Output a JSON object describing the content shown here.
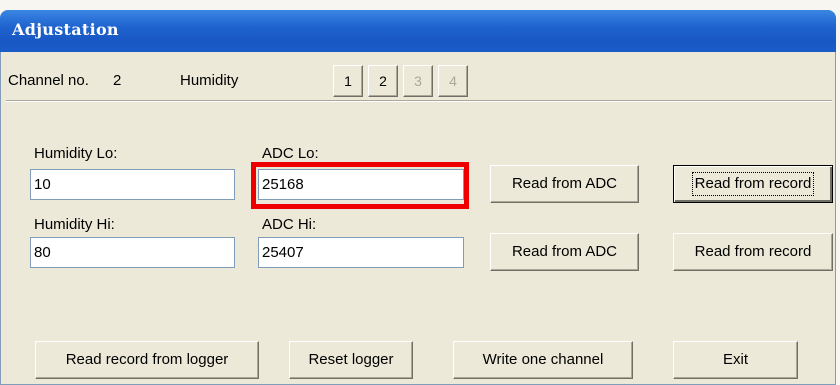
{
  "window": {
    "title": "Adjustation"
  },
  "header": {
    "channel_label": "Channel no.",
    "channel_number": "2",
    "channel_type": "Humidity",
    "channel_buttons": [
      {
        "label": "1",
        "enabled": true
      },
      {
        "label": "2",
        "enabled": true
      },
      {
        "label": "3",
        "enabled": false
      },
      {
        "label": "4",
        "enabled": false
      }
    ]
  },
  "lo": {
    "value_label": "Humidity Lo:",
    "value": "10",
    "adc_label": "ADC Lo:",
    "adc_value": "25168",
    "read_adc_label": "Read from ADC",
    "read_record_label": "Read from record"
  },
  "hi": {
    "value_label": "Humidity Hi:",
    "value": "80",
    "adc_label": "ADC Hi:",
    "adc_value": "25407",
    "read_adc_label": "Read from ADC",
    "read_record_label": "Read from record"
  },
  "footer": {
    "read_record_label": "Read record from logger",
    "reset_label": "Reset logger",
    "write_label": "Write one channel",
    "exit_label": "Exit"
  },
  "colors": {
    "highlight": "#ee0000",
    "titlebar": "#1f63cf"
  }
}
